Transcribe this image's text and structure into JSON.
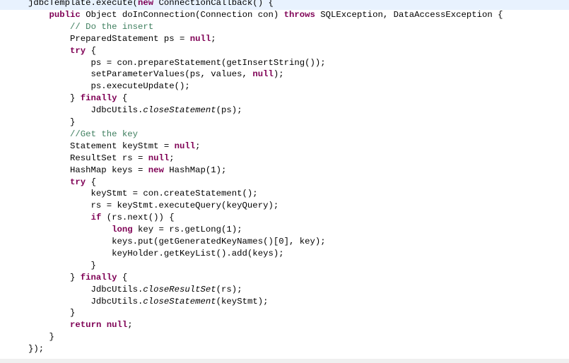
{
  "colors": {
    "keyword": "#7f0055",
    "comment": "#3f7f5f",
    "current_line": "#e8f2fe",
    "text": "#000000"
  },
  "current_line_index": 0,
  "lines": [
    [
      {
        "t": "jdbcTemplate.execute("
      },
      {
        "t": "new",
        "c": "k"
      },
      {
        "t": " ConnectionCallback() {"
      }
    ],
    [
      {
        "t": "    "
      },
      {
        "t": "public",
        "c": "k"
      },
      {
        "t": " Object doInConnection(Connection con) "
      },
      {
        "t": "throws",
        "c": "k"
      },
      {
        "t": " SQLException, DataAccessException {"
      }
    ],
    [
      {
        "t": "        "
      },
      {
        "t": "// Do the insert",
        "c": "cm"
      }
    ],
    [
      {
        "t": "        PreparedStatement ps = "
      },
      {
        "t": "null",
        "c": "k"
      },
      {
        "t": ";"
      }
    ],
    [
      {
        "t": "        "
      },
      {
        "t": "try",
        "c": "k"
      },
      {
        "t": " {"
      }
    ],
    [
      {
        "t": "            ps = con.prepareStatement(getInsertString());"
      }
    ],
    [
      {
        "t": "            setParameterValues(ps, values, "
      },
      {
        "t": "null",
        "c": "k"
      },
      {
        "t": ");"
      }
    ],
    [
      {
        "t": "            ps.executeUpdate();"
      }
    ],
    [
      {
        "t": "        } "
      },
      {
        "t": "finally",
        "c": "k"
      },
      {
        "t": " {"
      }
    ],
    [
      {
        "t": "            JdbcUtils."
      },
      {
        "t": "closeStatement",
        "c": "it"
      },
      {
        "t": "(ps);"
      }
    ],
    [
      {
        "t": "        }"
      }
    ],
    [
      {
        "t": "        "
      },
      {
        "t": "//Get the key",
        "c": "cm"
      }
    ],
    [
      {
        "t": "        Statement keyStmt = "
      },
      {
        "t": "null",
        "c": "k"
      },
      {
        "t": ";"
      }
    ],
    [
      {
        "t": "        ResultSet rs = "
      },
      {
        "t": "null",
        "c": "k"
      },
      {
        "t": ";"
      }
    ],
    [
      {
        "t": "        HashMap keys = "
      },
      {
        "t": "new",
        "c": "k"
      },
      {
        "t": " HashMap(1);"
      }
    ],
    [
      {
        "t": "        "
      },
      {
        "t": "try",
        "c": "k"
      },
      {
        "t": " {"
      }
    ],
    [
      {
        "t": "            keyStmt = con.createStatement();"
      }
    ],
    [
      {
        "t": "            rs = keyStmt.executeQuery(keyQuery);"
      }
    ],
    [
      {
        "t": "            "
      },
      {
        "t": "if",
        "c": "k"
      },
      {
        "t": " (rs.next()) {"
      }
    ],
    [
      {
        "t": "                "
      },
      {
        "t": "long",
        "c": "k"
      },
      {
        "t": " key = rs.getLong(1);"
      }
    ],
    [
      {
        "t": "                keys.put(getGeneratedKeyNames()[0], key);"
      }
    ],
    [
      {
        "t": "                keyHolder.getKeyList().add(keys);"
      }
    ],
    [
      {
        "t": "            }"
      }
    ],
    [
      {
        "t": "        } "
      },
      {
        "t": "finally",
        "c": "k"
      },
      {
        "t": " {"
      }
    ],
    [
      {
        "t": "            JdbcUtils."
      },
      {
        "t": "closeResultSet",
        "c": "it"
      },
      {
        "t": "(rs);"
      }
    ],
    [
      {
        "t": "            JdbcUtils."
      },
      {
        "t": "closeStatement",
        "c": "it"
      },
      {
        "t": "(keyStmt);"
      }
    ],
    [
      {
        "t": "        }"
      }
    ],
    [
      {
        "t": "        "
      },
      {
        "t": "return",
        "c": "k"
      },
      {
        "t": " "
      },
      {
        "t": "null",
        "c": "k"
      },
      {
        "t": ";"
      }
    ],
    [
      {
        "t": "    }"
      }
    ],
    [
      {
        "t": "});"
      }
    ]
  ]
}
